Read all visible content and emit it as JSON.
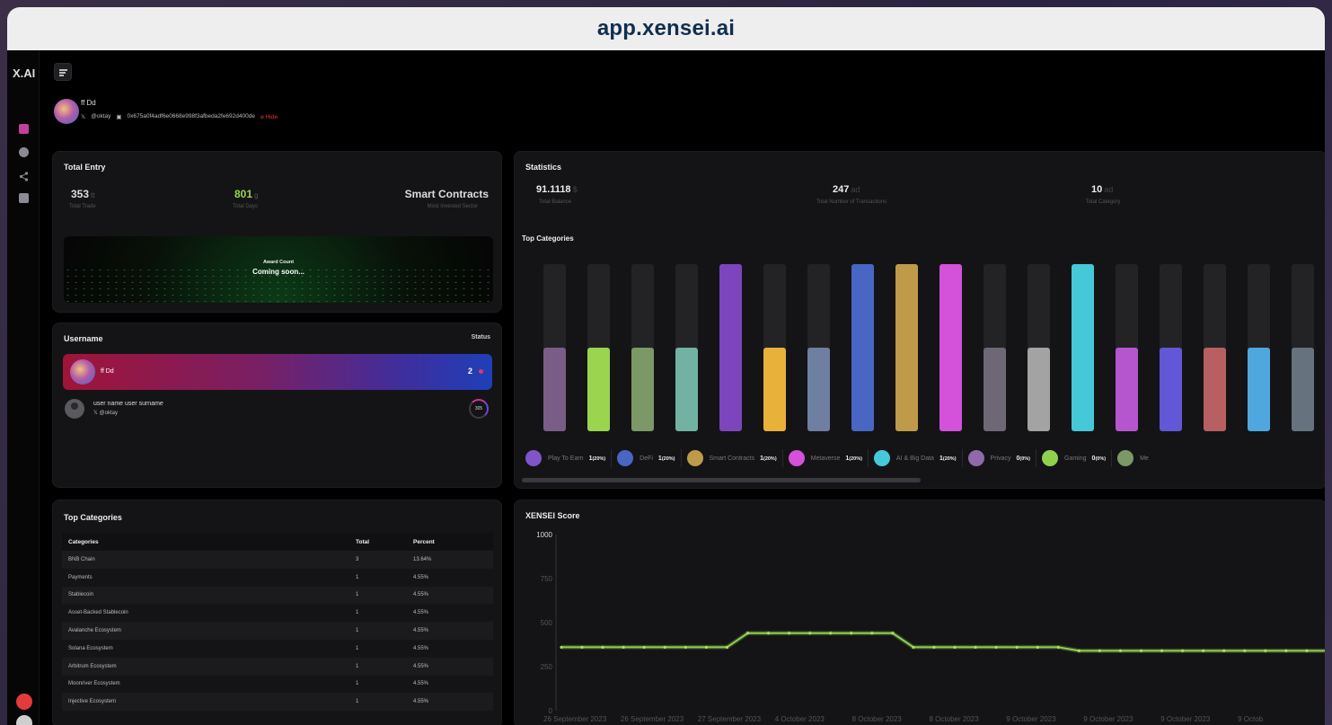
{
  "browser": {
    "url": "app.xensei.ai"
  },
  "sidebar": {
    "brand": "X.AI",
    "icons": [
      "dashboard-icon",
      "globe-icon",
      "share-icon",
      "wallet-icon"
    ],
    "bottom_icons": [
      "support-icon",
      "theme-icon"
    ]
  },
  "profile": {
    "name": "ff Dd",
    "x_handle": "@oktay",
    "wallet": "0x675a0f4adf6e0668e998f3afbeda2fe692d400de",
    "hide_label": "Hide"
  },
  "total_entry": {
    "title": "Total Entry",
    "trade_value": "353",
    "trade_unit": "tt",
    "trade_label": "Total Trade",
    "days_value": "801",
    "days_unit": "g",
    "days_label": "Total Days",
    "sector_value": "Smart Contracts",
    "sector_label": "Most Invested Sector",
    "award_title": "Award Count",
    "award_status": "Coming soon..."
  },
  "leaderboard": {
    "title": "Username",
    "status_label": "Status",
    "top_user": {
      "name": "ff Dd",
      "rank": "2"
    },
    "second_user": {
      "name": "user name user surname",
      "handle": "@oktay",
      "score": "305"
    }
  },
  "top_categories_table": {
    "title": "Top Categories",
    "headers": [
      "Categories",
      "Total",
      "Percent"
    ],
    "rows": [
      [
        "BNB Chain",
        "3",
        "13.64%"
      ],
      [
        "Payments",
        "1",
        "4.55%"
      ],
      [
        "Stablecoin",
        "1",
        "4.55%"
      ],
      [
        "Asset-Backed Stablecoin",
        "1",
        "4.55%"
      ],
      [
        "Avalanche Ecosystem",
        "1",
        "4.55%"
      ],
      [
        "Solana Ecosystem",
        "1",
        "4.55%"
      ],
      [
        "Arbitrum Ecosystem",
        "1",
        "4.55%"
      ],
      [
        "Moonriver Ecosystem",
        "1",
        "4.55%"
      ],
      [
        "Injective Ecosystem",
        "1",
        "4.55%"
      ]
    ]
  },
  "statistics": {
    "title": "Statistics",
    "balance_value": "91.1118",
    "balance_unit": "$",
    "balance_label": "Total Balance",
    "tx_value": "247",
    "tx_unit": "ad",
    "tx_label": "Total Number of Transactions",
    "cat_value": "10",
    "cat_unit": "ad",
    "cat_label": "Total Category",
    "top_categories_title": "Top Categories",
    "bars": [
      {
        "level": 0.5,
        "color": "#7a5d86"
      },
      {
        "level": 0.5,
        "color": "#9bd44f"
      },
      {
        "level": 0.5,
        "color": "#7b9866"
      },
      {
        "level": 0.5,
        "color": "#71b2a3"
      },
      {
        "level": 1.0,
        "color": "#7c45bd"
      },
      {
        "level": 0.5,
        "color": "#e8b13a"
      },
      {
        "level": 0.5,
        "color": "#6f7fa1"
      },
      {
        "level": 1.0,
        "color": "#4a66c4"
      },
      {
        "level": 1.0,
        "color": "#bf9a48"
      },
      {
        "level": 1.0,
        "color": "#d451d9"
      },
      {
        "level": 0.5,
        "color": "#6e6876"
      },
      {
        "level": 0.5,
        "color": "#a3a3a3"
      },
      {
        "level": 1.0,
        "color": "#45c9d8"
      },
      {
        "level": 0.5,
        "color": "#b656cf"
      },
      {
        "level": 0.5,
        "color": "#6257d6"
      },
      {
        "level": 0.5,
        "color": "#b85f62"
      },
      {
        "level": 0.5,
        "color": "#4fa8dd"
      },
      {
        "level": 0.5,
        "color": "#66737e"
      }
    ],
    "legend": [
      {
        "label": "Play To Earn",
        "count": "1",
        "pct": "(20%)",
        "color": "#7f55c9",
        "icon": "controller-icon"
      },
      {
        "label": "DeFi",
        "count": "1",
        "pct": "(20%)",
        "color": "#4a66c4",
        "icon": "defi-icon"
      },
      {
        "label": "Smart Contracts",
        "count": "1",
        "pct": "(20%)",
        "color": "#bf9a48",
        "icon": "contract-icon"
      },
      {
        "label": "Metaverse",
        "count": "1",
        "pct": "(20%)",
        "color": "#d451d9",
        "icon": "metaverse-icon"
      },
      {
        "label": "AI & Big Data",
        "count": "1",
        "pct": "(20%)",
        "color": "#45c9d8",
        "icon": "ai-icon"
      },
      {
        "label": "Privacy",
        "count": "0",
        "pct": "(0%)",
        "color": "#8e6aa8",
        "icon": "privacy-icon"
      },
      {
        "label": "Gaming",
        "count": "0",
        "pct": "(0%)",
        "color": "#8fd14f",
        "icon": "gaming-icon"
      },
      {
        "label": "Me",
        "count": "",
        "pct": "",
        "color": "#7b9866",
        "icon": "meme-icon"
      }
    ]
  },
  "score": {
    "title": "XENSEI Score"
  },
  "chart_data": {
    "type": "line",
    "title": "XENSEI Score",
    "ylim": [
      0,
      1000
    ],
    "yticks": [
      "1000",
      "750",
      "500",
      "250",
      "0"
    ],
    "xticks": [
      "26 September 2023",
      "26 September 2023",
      "27 September 2023",
      "4 October 2023",
      "8 October 2023",
      "8 October 2023",
      "9 October 2023",
      "9 October 2023",
      "9 October 2023",
      "9 Octob"
    ],
    "color": "#8fd14f",
    "x": [
      0,
      1,
      2,
      3,
      4,
      5,
      6,
      7,
      8,
      9,
      10,
      11,
      12,
      13,
      14,
      15,
      16,
      17,
      18,
      19,
      20,
      21,
      22,
      23,
      24,
      25,
      26,
      27,
      28,
      29,
      30,
      31,
      32,
      33,
      34,
      35,
      36,
      37
    ],
    "values": [
      360,
      360,
      360,
      360,
      360,
      360,
      360,
      360,
      360,
      440,
      440,
      440,
      440,
      440,
      440,
      440,
      440,
      360,
      360,
      360,
      360,
      360,
      360,
      360,
      360,
      340,
      340,
      340,
      340,
      340,
      340,
      340,
      340,
      340,
      340,
      340,
      340,
      340
    ]
  }
}
